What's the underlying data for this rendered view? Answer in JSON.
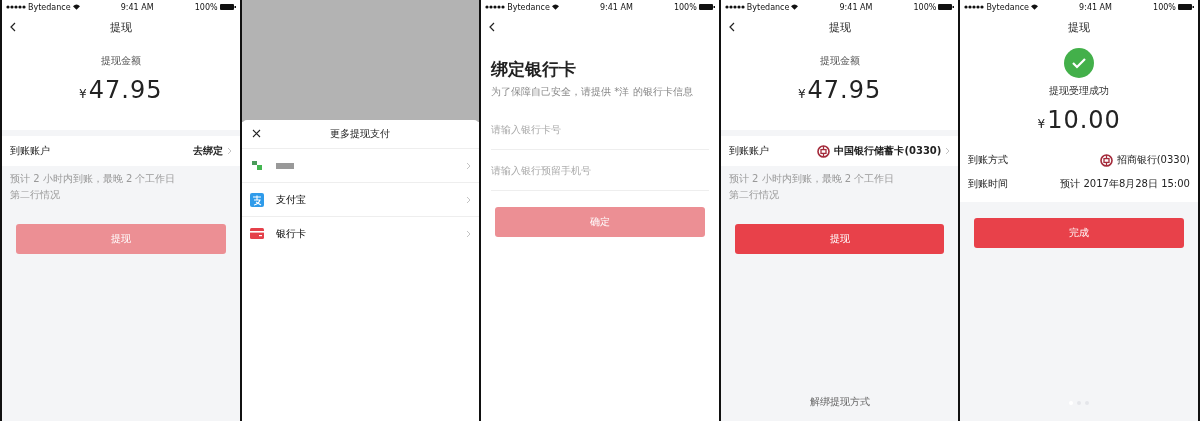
{
  "screens": [
    {
      "kind": "withdraw",
      "status_bar": {
        "carrier": "Bytedance",
        "time": "9:41 AM",
        "battery": "100%"
      },
      "back": true,
      "title": "提现",
      "amount_label": "提现金额",
      "currency": "¥",
      "amount": "47.95",
      "account": {
        "label": "到账账户",
        "value": "去绑定",
        "bank_icon": false
      },
      "hints": [
        "预计 2 小时内到账，最晚 2 个工作日",
        "第二行情况"
      ],
      "button": {
        "label": "提现",
        "disabled": true
      }
    },
    {
      "kind": "sheet",
      "title": "更多提现支付",
      "options": [
        {
          "kind": "wechat"
        },
        {
          "kind": "alipay",
          "label": "支付宝"
        },
        {
          "kind": "card",
          "label": "银行卡"
        }
      ]
    },
    {
      "kind": "bind",
      "status_bar": {
        "carrier": "Bytedance",
        "time": "9:41 AM",
        "battery": "100%"
      },
      "back": true,
      "title": "绑定银行卡",
      "subtitle": "为了保障自己安全，请提供 *洋 的银行卡信息",
      "fields": [
        {
          "placeholder": "请输入银行卡号"
        },
        {
          "placeholder": "请输入银行预留手机号"
        }
      ],
      "button": {
        "label": "确定",
        "disabled": true
      }
    },
    {
      "kind": "withdraw",
      "status_bar": {
        "carrier": "Bytedance",
        "time": "9:41 AM",
        "battery": "100%"
      },
      "back": true,
      "title": "提现",
      "amount_label": "提现金额",
      "currency": "¥",
      "amount": "47.95",
      "account": {
        "label": "到账账户",
        "value": "中国银行储蓄卡(0330)",
        "bank_icon": true
      },
      "hints": [
        "预计 2 小时内到账，最晚 2 个工作日",
        "第二行情况"
      ],
      "button": {
        "label": "提现",
        "disabled": false
      },
      "footer_link": "解绑提现方式"
    },
    {
      "kind": "success",
      "status_bar": {
        "carrier": "Bytedance",
        "time": "9:41 AM",
        "battery": "100%"
      },
      "back": false,
      "title": "提现",
      "message": "提现受理成功",
      "currency": "¥",
      "amount": "10.00",
      "rows": [
        {
          "label": "到账方式",
          "value": "招商银行(0330)",
          "bank_icon": true
        },
        {
          "label": "到账时间",
          "value": "预计 2017年8月28日 15:00",
          "bank_icon": false
        }
      ],
      "button": {
        "label": "完成",
        "disabled": false
      },
      "page_dots": [
        {
          "selected": true
        },
        {
          "selected": false
        },
        {
          "selected": false
        }
      ]
    }
  ]
}
